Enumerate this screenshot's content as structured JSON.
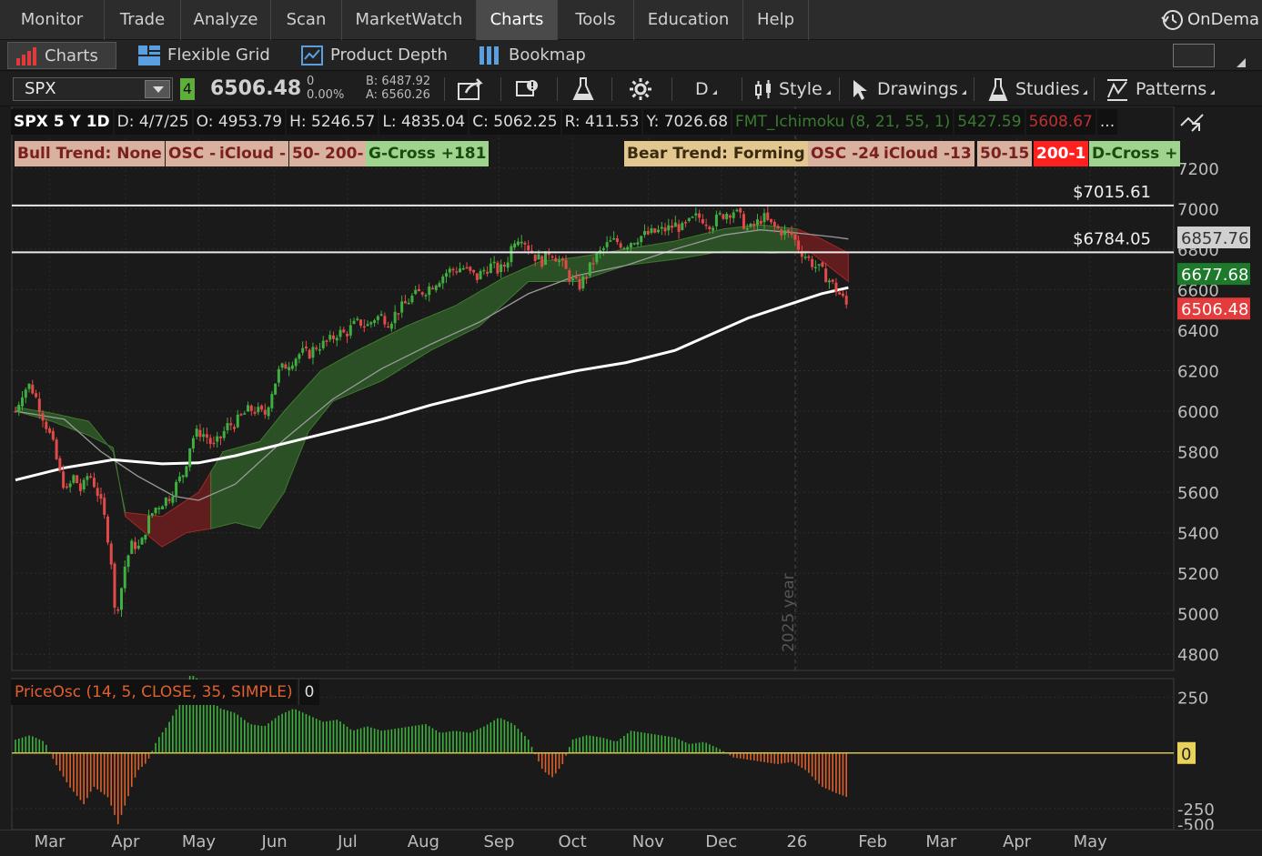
{
  "menu": {
    "items": [
      {
        "label": "Monitor",
        "active": false
      },
      {
        "label": "Trade",
        "active": false
      },
      {
        "label": "Analyze",
        "active": false
      },
      {
        "label": "Scan",
        "active": false
      },
      {
        "label": "MarketWatch",
        "active": false
      },
      {
        "label": "Charts",
        "active": true
      },
      {
        "label": "Tools",
        "active": false
      },
      {
        "label": "Education",
        "active": false
      },
      {
        "label": "Help",
        "active": false
      }
    ],
    "ondemand": "OnDema"
  },
  "subtabs": {
    "charts": "Charts",
    "flexible_grid": "Flexible Grid",
    "product_depth": "Product Depth",
    "bookmap": "Bookmap"
  },
  "toolbar": {
    "symbol": "SPX",
    "link_number": "4",
    "last": "6506.48",
    "change": "0",
    "change_pct": "0.00%",
    "bid": "B: 6487.92",
    "ask": "A: 6560.26",
    "aggregation": "D",
    "style": "Style",
    "drawings": "Drawings",
    "studies": "Studies",
    "patterns": "Patterns"
  },
  "info_bar": {
    "title": "SPX 5 Y 1D",
    "date": "D: 4/7/25",
    "open": "O: 4953.79",
    "high": "H: 5246.57",
    "low": "L: 4835.04",
    "close": "C: 5062.25",
    "range": "R: 411.53",
    "y": "Y: 7026.68",
    "ichimoku": "FMT_Ichimoku (8, 21, 55, 1)",
    "ich_val1": "5427.59",
    "ich_val2": "5608.67",
    "more": "..."
  },
  "labels_left": {
    "bull_trend": "Bull Trend: None",
    "osc": "OSC -",
    "icloud": "iCloud -",
    "ma50": "50-",
    "ma200": "200-",
    "gcross": "G-Cross +181"
  },
  "labels_right": {
    "bear_trend": "Bear Trend: Forming",
    "osc": "OSC -24",
    "icloud": "iCloud -13",
    "ma50": "50-15",
    "ma200": "200-1",
    "dcross": "D-Cross +"
  },
  "colors": {
    "up": "#3faf3f",
    "down": "#e24a4a",
    "cloud_green": "#2f5a28",
    "cloud_red": "#6e1e1e",
    "ma200": "#ffffff",
    "ma50": "#9a9a9a",
    "osc_up": "#3db33d",
    "osc_down": "#e0602a",
    "zero_line": "#d8c34a"
  },
  "price_badges": [
    {
      "text": "6857.76",
      "bg": "#d0d0d0",
      "fg": "#333333",
      "value": 6857.76
    },
    {
      "text": "6677.68",
      "bg": "#1d7a2a",
      "fg": "#ffffff",
      "value": 6677.68
    },
    {
      "text": "6506.48",
      "bg": "#e43c3c",
      "fg": "#ffffff",
      "value": 6506.48
    }
  ],
  "osc_badge": {
    "text": "0",
    "bg": "#e8d25a",
    "fg": "#222222",
    "value": 0
  },
  "oscillator_label": "PriceOsc (14, 5, CLOSE, 35, SIMPLE)",
  "oscillator_value": "0",
  "year_marker": "2025 year",
  "chart_data": {
    "type": "line",
    "ylim": [
      4720,
      7280
    ],
    "y_ticks": [
      "7200",
      "7000",
      "6800",
      "6600",
      "6400",
      "6200",
      "6000",
      "5800",
      "5600",
      "5400",
      "5200",
      "5000",
      "4800"
    ],
    "y_tick_values": [
      7200,
      7000,
      6800,
      6600,
      6400,
      6200,
      6000,
      5800,
      5600,
      5400,
      5200,
      5000,
      4800
    ],
    "x_ticks": [
      "Mar",
      "Apr",
      "May",
      "Jun",
      "Jul",
      "Aug",
      "Sep",
      "Oct",
      "Nov",
      "Dec",
      "26",
      "Feb",
      "Mar",
      "Apr",
      "May"
    ],
    "x_tick_days": [
      14,
      45,
      75,
      106,
      136,
      167,
      198,
      228,
      259,
      289,
      320,
      351,
      379,
      410,
      440
    ],
    "horizontal_lines": [
      {
        "label": "$7015.61",
        "value": 7015.61
      },
      {
        "label": "$6784.05",
        "value": 6784.05
      }
    ],
    "price_series": [
      [
        0,
        6000
      ],
      [
        3,
        6100
      ],
      [
        6,
        6130
      ],
      [
        9,
        6050
      ],
      [
        12,
        5950
      ],
      [
        15,
        5850
      ],
      [
        18,
        5700
      ],
      [
        21,
        5600
      ],
      [
        24,
        5680
      ],
      [
        27,
        5600
      ],
      [
        30,
        5700
      ],
      [
        33,
        5620
      ],
      [
        36,
        5500
      ],
      [
        39,
        5300
      ],
      [
        40,
        5100
      ],
      [
        41,
        4960
      ],
      [
        42,
        5050
      ],
      [
        43,
        5100
      ],
      [
        45,
        5250
      ],
      [
        48,
        5350
      ],
      [
        51,
        5320
      ],
      [
        54,
        5450
      ],
      [
        57,
        5520
      ],
      [
        60,
        5550
      ],
      [
        63,
        5580
      ],
      [
        66,
        5640
      ],
      [
        69,
        5700
      ],
      [
        72,
        5860
      ],
      [
        75,
        5900
      ],
      [
        78,
        5880
      ],
      [
        81,
        5820
      ],
      [
        84,
        5870
      ],
      [
        87,
        5930
      ],
      [
        90,
        5940
      ],
      [
        93,
        5980
      ],
      [
        96,
        6010
      ],
      [
        99,
        6000
      ],
      [
        102,
        5980
      ],
      [
        105,
        6100
      ],
      [
        108,
        6200
      ],
      [
        111,
        6230
      ],
      [
        114,
        6260
      ],
      [
        117,
        6290
      ],
      [
        120,
        6280
      ],
      [
        123,
        6320
      ],
      [
        126,
        6330
      ],
      [
        129,
        6350
      ],
      [
        132,
        6390
      ],
      [
        135,
        6380
      ],
      [
        138,
        6420
      ],
      [
        141,
        6440
      ],
      [
        144,
        6420
      ],
      [
        147,
        6460
      ],
      [
        150,
        6470
      ],
      [
        153,
        6440
      ],
      [
        156,
        6490
      ],
      [
        159,
        6520
      ],
      [
        162,
        6560
      ],
      [
        165,
        6580
      ],
      [
        168,
        6600
      ],
      [
        171,
        6630
      ],
      [
        174,
        6660
      ],
      [
        177,
        6690
      ],
      [
        180,
        6700
      ],
      [
        183,
        6710
      ],
      [
        186,
        6680
      ],
      [
        189,
        6660
      ],
      [
        192,
        6700
      ],
      [
        195,
        6720
      ],
      [
        198,
        6690
      ],
      [
        201,
        6730
      ],
      [
        204,
        6850
      ],
      [
        207,
        6870
      ],
      [
        210,
        6810
      ],
      [
        213,
        6760
      ],
      [
        216,
        6740
      ],
      [
        219,
        6800
      ],
      [
        222,
        6750
      ],
      [
        225,
        6700
      ],
      [
        228,
        6640
      ],
      [
        231,
        6620
      ],
      [
        234,
        6680
      ],
      [
        237,
        6750
      ],
      [
        240,
        6790
      ],
      [
        243,
        6830
      ],
      [
        246,
        6840
      ],
      [
        249,
        6820
      ],
      [
        252,
        6840
      ],
      [
        255,
        6860
      ],
      [
        258,
        6870
      ],
      [
        261,
        6880
      ],
      [
        264,
        6890
      ],
      [
        267,
        6900
      ],
      [
        270,
        6920
      ],
      [
        273,
        6900
      ],
      [
        276,
        6930
      ],
      [
        279,
        6960
      ],
      [
        282,
        6950
      ],
      [
        285,
        6920
      ],
      [
        288,
        6960
      ],
      [
        291,
        6980
      ],
      [
        294,
        6990
      ],
      [
        297,
        6950
      ],
      [
        300,
        6890
      ],
      [
        303,
        6920
      ],
      [
        306,
        6960
      ],
      [
        309,
        6920
      ],
      [
        312,
        6900
      ],
      [
        315,
        6880
      ],
      [
        318,
        6870
      ],
      [
        321,
        6800
      ],
      [
        324,
        6760
      ],
      [
        327,
        6720
      ],
      [
        330,
        6690
      ],
      [
        333,
        6650
      ],
      [
        336,
        6600
      ],
      [
        339,
        6550
      ],
      [
        341,
        6506
      ]
    ],
    "sma200": [
      [
        0,
        5660
      ],
      [
        20,
        5720
      ],
      [
        40,
        5760
      ],
      [
        60,
        5740
      ],
      [
        75,
        5745
      ],
      [
        90,
        5780
      ],
      [
        110,
        5840
      ],
      [
        130,
        5900
      ],
      [
        150,
        5960
      ],
      [
        170,
        6030
      ],
      [
        190,
        6090
      ],
      [
        210,
        6150
      ],
      [
        230,
        6200
      ],
      [
        250,
        6240
      ],
      [
        270,
        6300
      ],
      [
        285,
        6380
      ],
      [
        300,
        6460
      ],
      [
        315,
        6520
      ],
      [
        330,
        6580
      ],
      [
        341,
        6610
      ]
    ],
    "sma50": [
      [
        0,
        6000
      ],
      [
        20,
        5960
      ],
      [
        35,
        5800
      ],
      [
        50,
        5680
      ],
      [
        65,
        5580
      ],
      [
        75,
        5560
      ],
      [
        90,
        5640
      ],
      [
        110,
        5860
      ],
      [
        130,
        6060
      ],
      [
        150,
        6210
      ],
      [
        170,
        6330
      ],
      [
        190,
        6440
      ],
      [
        210,
        6580
      ],
      [
        230,
        6670
      ],
      [
        250,
        6720
      ],
      [
        270,
        6800
      ],
      [
        290,
        6870
      ],
      [
        305,
        6895
      ],
      [
        320,
        6880
      ],
      [
        335,
        6860
      ],
      [
        341,
        6850
      ]
    ],
    "cloud_top": [
      [
        0,
        6020
      ],
      [
        15,
        5990
      ],
      [
        30,
        5950
      ],
      [
        40,
        5800
      ],
      [
        45,
        5500
      ],
      [
        60,
        5480
      ],
      [
        75,
        5600
      ],
      [
        85,
        5800
      ],
      [
        100,
        5850
      ],
      [
        110,
        6000
      ],
      [
        125,
        6200
      ],
      [
        140,
        6300
      ],
      [
        160,
        6420
      ],
      [
        180,
        6520
      ],
      [
        200,
        6660
      ],
      [
        215,
        6740
      ],
      [
        230,
        6760
      ],
      [
        250,
        6800
      ],
      [
        270,
        6840
      ],
      [
        290,
        6900
      ],
      [
        305,
        6920
      ],
      [
        320,
        6900
      ],
      [
        330,
        6850
      ],
      [
        341,
        6780
      ]
    ],
    "cloud_bottom": [
      [
        0,
        6000
      ],
      [
        15,
        5950
      ],
      [
        30,
        5880
      ],
      [
        40,
        5820
      ],
      [
        45,
        5480
      ],
      [
        60,
        5330
      ],
      [
        70,
        5400
      ],
      [
        80,
        5420
      ],
      [
        90,
        5450
      ],
      [
        100,
        5420
      ],
      [
        110,
        5600
      ],
      [
        120,
        5900
      ],
      [
        130,
        6050
      ],
      [
        150,
        6150
      ],
      [
        170,
        6300
      ],
      [
        190,
        6420
      ],
      [
        210,
        6640
      ],
      [
        230,
        6640
      ],
      [
        250,
        6720
      ],
      [
        270,
        6750
      ],
      [
        290,
        6790
      ],
      [
        310,
        6780
      ],
      [
        325,
        6790
      ],
      [
        341,
        6640
      ]
    ],
    "oscillator": {
      "ylim": [
        -340,
        330
      ],
      "y_ticks": [
        "250",
        "-250",
        "-500"
      ],
      "y_tick_values": [
        250,
        -250,
        -500
      ],
      "values": [
        [
          0,
          60
        ],
        [
          6,
          80
        ],
        [
          12,
          50
        ],
        [
          16,
          -40
        ],
        [
          22,
          -150
        ],
        [
          28,
          -230
        ],
        [
          32,
          -150
        ],
        [
          38,
          -200
        ],
        [
          42,
          -320
        ],
        [
          46,
          -200
        ],
        [
          50,
          -80
        ],
        [
          54,
          -40
        ],
        [
          58,
          60
        ],
        [
          62,
          120
        ],
        [
          66,
          200
        ],
        [
          70,
          300
        ],
        [
          72,
          380
        ],
        [
          75,
          320
        ],
        [
          78,
          250
        ],
        [
          84,
          200
        ],
        [
          90,
          180
        ],
        [
          96,
          130
        ],
        [
          102,
          120
        ],
        [
          108,
          170
        ],
        [
          114,
          200
        ],
        [
          120,
          170
        ],
        [
          126,
          140
        ],
        [
          132,
          150
        ],
        [
          138,
          100
        ],
        [
          144,
          120
        ],
        [
          150,
          100
        ],
        [
          156,
          110
        ],
        [
          162,
          120
        ],
        [
          168,
          130
        ],
        [
          174,
          90
        ],
        [
          180,
          100
        ],
        [
          186,
          90
        ],
        [
          192,
          120
        ],
        [
          198,
          160
        ],
        [
          204,
          130
        ],
        [
          210,
          60
        ],
        [
          216,
          -80
        ],
        [
          220,
          -110
        ],
        [
          224,
          -50
        ],
        [
          228,
          60
        ],
        [
          234,
          80
        ],
        [
          240,
          70
        ],
        [
          246,
          50
        ],
        [
          252,
          100
        ],
        [
          258,
          90
        ],
        [
          264,
          80
        ],
        [
          270,
          70
        ],
        [
          276,
          40
        ],
        [
          282,
          50
        ],
        [
          288,
          20
        ],
        [
          294,
          -20
        ],
        [
          300,
          -30
        ],
        [
          306,
          -40
        ],
        [
          312,
          -50
        ],
        [
          318,
          -40
        ],
        [
          324,
          -80
        ],
        [
          330,
          -150
        ],
        [
          336,
          -180
        ],
        [
          341,
          -200
        ]
      ]
    }
  }
}
